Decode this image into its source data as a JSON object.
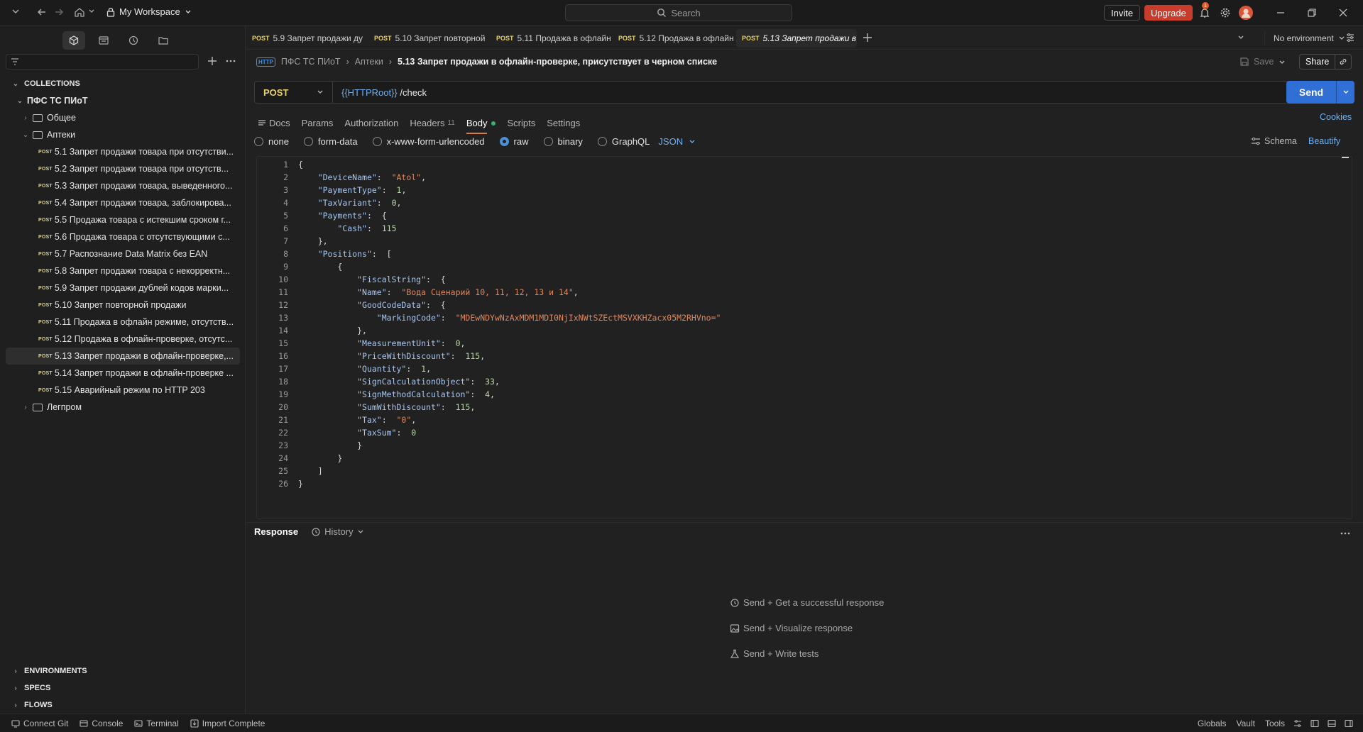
{
  "topbar": {
    "workspace": "My Workspace",
    "search_placeholder": "Search",
    "invite": "Invite",
    "upgrade": "Upgrade",
    "notification_count": "1"
  },
  "sidebar": {
    "collections_label": "COLLECTIONS",
    "collection_name": "ПФС ТС ПИоТ",
    "folders": [
      "Общее",
      "Аптеки",
      "Легпром"
    ],
    "method_label": "POST",
    "requests": [
      "5.1 Запрет продажи товара при отсутстви...",
      "5.2 Запрет продажи товара при отсутств...",
      "5.3 Запрет продажи товара, выведенного...",
      "5.4 Запрет продажи товара, заблокирова...",
      "5.5 Продажа товара с истекшим сроком г...",
      "5.6 Продажа товара с отсутствующими с...",
      "5.7 Распознание Data Matrix без EAN",
      "5.8 Запрет продажи товара с некорректн...",
      "5.9 Запрет продажи дублей кодов марки...",
      "5.10 Запрет повторной продажи",
      "5.11 Продажа в офлайн режиме, отсутств...",
      "5.12 Продажа в офлайн-проверке, отсутс...",
      "5.13 Запрет продажи в офлайн-проверке,...",
      "5.14 Запрет продажи в офлайн-проверке ...",
      "5.15 Аварийный режим по HTTP 203"
    ],
    "sections": [
      "ENVIRONMENTS",
      "SPECS",
      "FLOWS"
    ]
  },
  "tabs": [
    {
      "method": "POST",
      "label": "5.9 Запрет продажи ду"
    },
    {
      "method": "POST",
      "label": "5.10 Запрет повторной"
    },
    {
      "method": "POST",
      "label": "5.11 Продажа в офлайн"
    },
    {
      "method": "POST",
      "label": "5.12 Продажа в офлайн"
    },
    {
      "method": "POST",
      "label": "5.13 Запрет продажи в"
    }
  ],
  "environment": "No environment",
  "breadcrumb": {
    "collection": "ПФС ТС ПИоТ",
    "folder": "Аптеки",
    "request": "5.13 Запрет продажи в офлайн-проверке, присутствует в черном списке",
    "save": "Save",
    "share": "Share"
  },
  "request": {
    "method": "POST",
    "url_var": "{{HTTPRoot}}",
    "url_path": " /check",
    "send": "Send"
  },
  "subtabs": {
    "docs": "Docs",
    "params": "Params",
    "authorization": "Authorization",
    "headers": "Headers",
    "headers_count": "11",
    "body": "Body",
    "scripts": "Scripts",
    "settings": "Settings",
    "cookies": "Cookies"
  },
  "body_types": {
    "options": [
      "none",
      "form-data",
      "x-www-form-urlencoded",
      "raw",
      "binary",
      "GraphQL"
    ],
    "selected": "raw",
    "format": "JSON",
    "schema": "Schema",
    "beautify": "Beautify"
  },
  "code_lines": [
    "{",
    "    \"DeviceName\":  \"Atol\",",
    "    \"PaymentType\":  1,",
    "    \"TaxVariant\":  0,",
    "    \"Payments\":  {",
    "        \"Cash\":  115",
    "    },",
    "    \"Positions\":  [",
    "        {",
    "            \"FiscalString\":  {",
    "            \"Name\":  \"Вода Сценарий 10, 11, 12, 13 и 14\",",
    "            \"GoodCodeData\":  {",
    "                \"MarkingCode\":  \"MDEwNDYwNzAxMDM1MDI0NjIxNWtSZEctMSVXKHZacx05M2RHVno=\"",
    "            },",
    "            \"MeasurementUnit\":  0,",
    "            \"PriceWithDiscount\":  115,",
    "            \"Quantity\":  1,",
    "            \"SignCalculationObject\":  33,",
    "            \"SignMethodCalculation\":  4,",
    "            \"SumWithDiscount\":  115,",
    "            \"Tax\":  \"0\",",
    "            \"TaxSum\":  0",
    "            }",
    "        }",
    "    ]",
    "}"
  ],
  "response": {
    "label": "Response",
    "history": "History",
    "hints": [
      "Send + Get a successful response",
      "Send + Visualize response",
      "Send + Write tests"
    ]
  },
  "statusbar": {
    "left": [
      "Connect Git",
      "Console",
      "Terminal",
      "Import Complete"
    ],
    "right": [
      "Globals",
      "Vault",
      "Tools"
    ]
  }
}
